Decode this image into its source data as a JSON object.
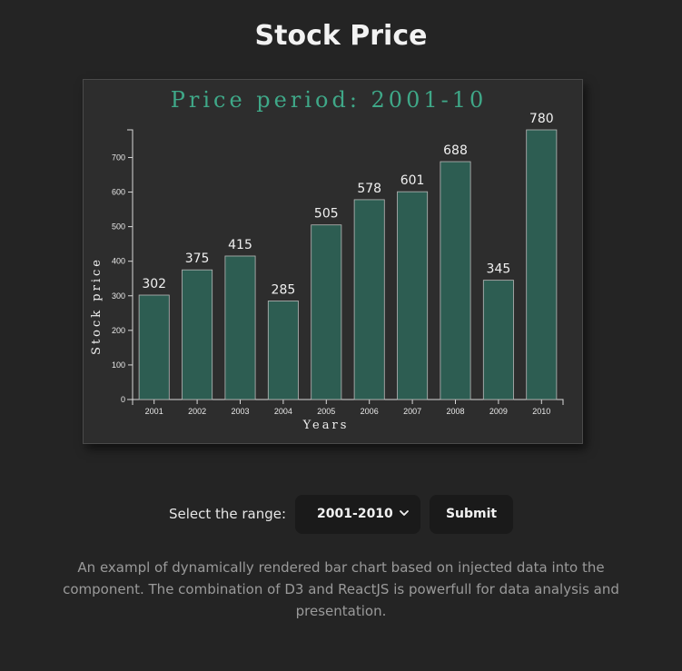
{
  "page": {
    "title": "Stock Price",
    "description": "An exampl of dynamically rendered bar chart based on injected data into the component. The combination of D3 and ReactJS is powerfull for data analysis and presentation."
  },
  "controls": {
    "range_label": "Select the range:",
    "range_selected": "2001-2010",
    "submit_label": "Submit"
  },
  "colors": {
    "background": "#242424",
    "card": "#2d2d2d",
    "bar_fill": "#2d5d52",
    "title_accent": "#3fa888"
  },
  "chart_data": {
    "type": "bar",
    "title": "Price period: 2001-10",
    "xlabel": "Years",
    "ylabel": "Stock price",
    "categories": [
      "2001",
      "2002",
      "2003",
      "2004",
      "2005",
      "2006",
      "2007",
      "2008",
      "2009",
      "2010"
    ],
    "values": [
      302,
      375,
      415,
      285,
      505,
      578,
      601,
      688,
      345,
      780
    ],
    "ylim": [
      0,
      780
    ],
    "yticks": [
      0,
      100,
      200,
      300,
      400,
      500,
      600,
      700
    ],
    "grid": false,
    "data_labels": true
  }
}
